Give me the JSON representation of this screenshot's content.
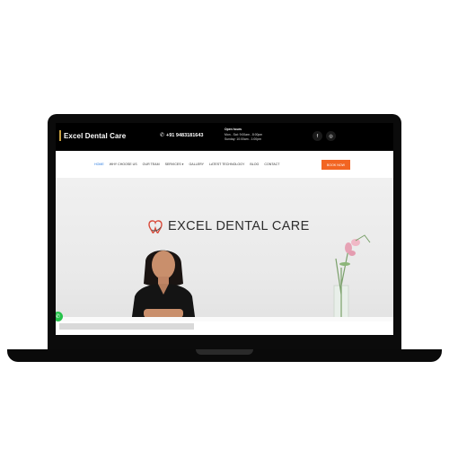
{
  "site": {
    "brand": "Excel Dental Care",
    "phone": "+91 9483181643",
    "hours": {
      "title": "Open hours",
      "weekdays": "Mon - Sat: 9:00am - 8:00pm",
      "sunday": "Sunday: 10:00am - 1:00pm"
    },
    "social": [
      {
        "icon": "facebook-icon",
        "glyph": "f"
      },
      {
        "icon": "instagram-icon",
        "glyph": "◎"
      }
    ]
  },
  "nav": {
    "items": [
      {
        "label": "HOME",
        "active": true
      },
      {
        "label": "WHY CHOOSE US",
        "active": false
      },
      {
        "label": "OUR TEAM",
        "active": false
      },
      {
        "label": "SERVICES ▾",
        "active": false
      },
      {
        "label": "GALLERY",
        "active": false
      },
      {
        "label": "LATEST TECHNOLOGY",
        "active": false
      },
      {
        "label": "BLOG",
        "active": false
      },
      {
        "label": "CONTACT",
        "active": false
      }
    ],
    "cta": "BOOK NOW"
  },
  "hero": {
    "logo_text": "EXCEL DENTAL CARE"
  },
  "colors": {
    "accent": "#f26522",
    "active_link": "#2a7be0",
    "whatsapp": "#25c24a"
  }
}
